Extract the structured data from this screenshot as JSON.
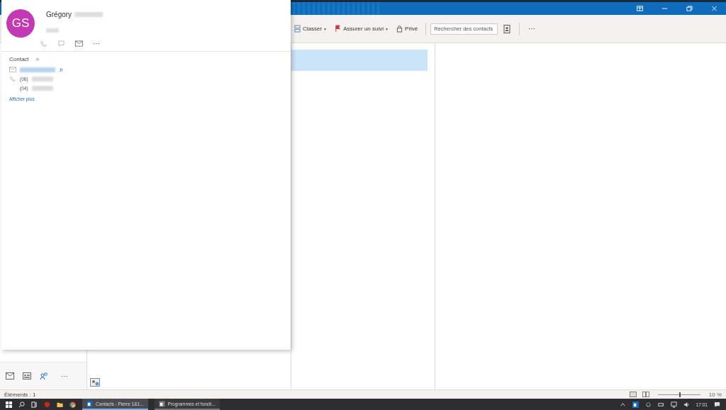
{
  "contact_card": {
    "initials": "GS",
    "first_name": "Grégory",
    "section_title": "Contact",
    "chevron": ">",
    "email_suffix": ".fr",
    "phones": [
      {
        "prefix": "(06)"
      },
      {
        "prefix": "(04)"
      }
    ],
    "show_more": "Afficher plus",
    "actions": [
      "⋯"
    ]
  },
  "ribbon": {
    "items": [
      {
        "kind": "menu",
        "label": "Classer",
        "caret": "▾"
      },
      {
        "kind": "flag",
        "label": "Assurer un suivi",
        "caret": "▾"
      },
      {
        "kind": "lock",
        "label": "Privé"
      }
    ],
    "search": {
      "placeholder": "Rechercher des contacts"
    },
    "more": "⋯"
  },
  "list": {
    "rows": [
      {
        "selected": true
      }
    ]
  },
  "nav": {
    "more": "⋯"
  },
  "status_bar": {
    "items": "Éléments : 1",
    "zoom": "10 %",
    "zoom_level": {
      "level": 0.5
    }
  },
  "taskbar": {
    "windows": [
      {
        "label": "Contacts - Pierre 1&1...",
        "selected": true
      },
      {
        "label": "Programmes et foncti...",
        "selected": false
      }
    ],
    "time": "17:01"
  }
}
